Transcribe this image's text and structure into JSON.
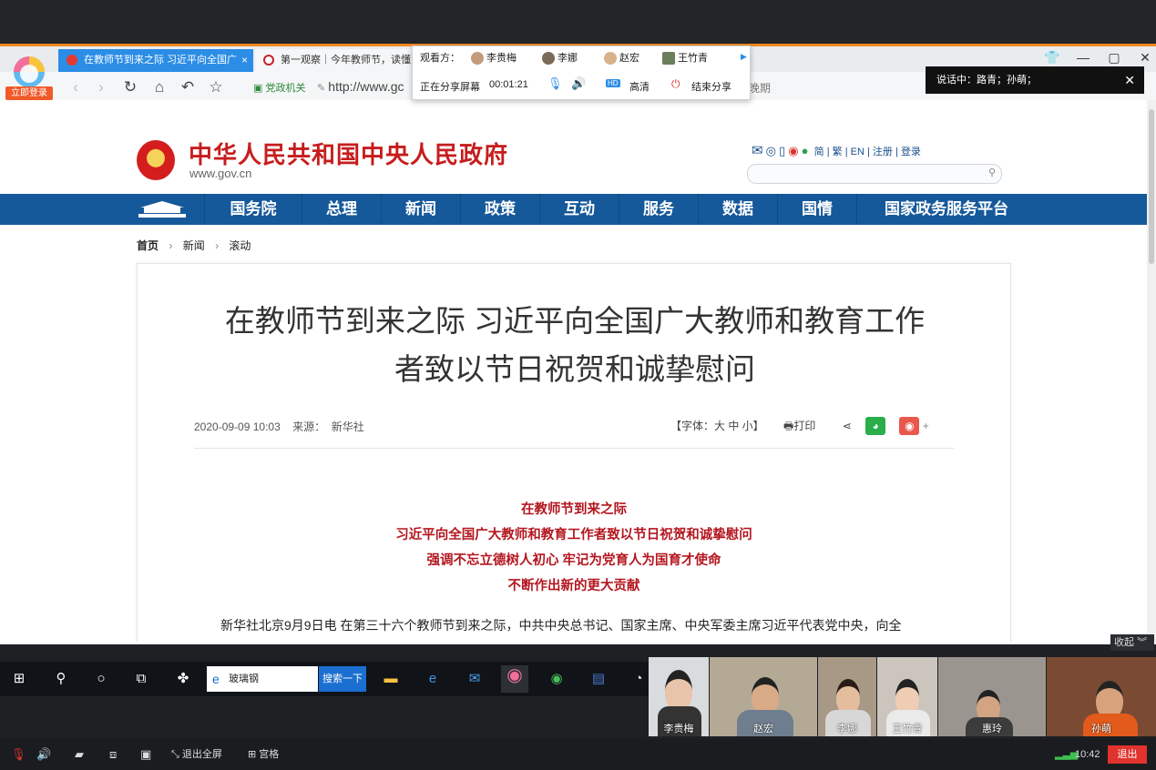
{
  "browser": {
    "tabs": [
      {
        "label": "在教师节到来之际 习近平向全国广",
        "close": "×"
      },
      {
        "label": "第一观察｜今年教师节，读懂"
      }
    ],
    "login_label": "立即登录",
    "bookmark1": "党政机关",
    "address": "http://www.gc",
    "address_tail": "晚期",
    "window_buttons": {
      "min": "—",
      "max": "▢",
      "close": "✕"
    }
  },
  "share": {
    "viewers_label": "观看方：",
    "viewers": [
      "李贵梅",
      "李娜",
      "赵宏",
      "王竹青"
    ],
    "sharing_label": "正在分享屏幕",
    "timer": "00:01:21",
    "hd_badge": "HD",
    "hd_label": "高清",
    "end_label": "结束分享"
  },
  "speaking": {
    "text": "说话中：路青；孙萌；",
    "close": "✕"
  },
  "site": {
    "name": "中华人民共和国中央人民政府",
    "url": "www.gov.cn",
    "top_links": [
      "简",
      "繁",
      "EN",
      "注册",
      "登录"
    ],
    "nav": [
      "国务院",
      "总理",
      "新闻",
      "政策",
      "互动",
      "服务",
      "数据",
      "国情",
      "国家政务服务平台"
    ],
    "breadcrumb": [
      "首页",
      "新闻",
      "滚动"
    ]
  },
  "article": {
    "title_line1": "在教师节到来之际 习近平向全国广大教师和教育工作",
    "title_line2": "者致以节日祝贺和诚挚慰问",
    "date": "2020-09-09 10:03",
    "source_label": "来源：",
    "source": "新华社",
    "font_size_label": "【字体：大 中 小】",
    "print_label": "打印",
    "lead": [
      "在教师节到来之际",
      "习近平向全国广大教师和教育工作者致以节日祝贺和诚挚慰问",
      "强调不忘立德树人初心 牢记为党育人为国育才使命",
      "不断作出新的更大贡献"
    ],
    "paragraph": "新华社北京9月9日电  在第三十六个教师节到来之际，中共中央总书记、国家主席、中央军委主席习近平代表党中央，向全"
  },
  "taskbar": {
    "search_value": "玻璃钢",
    "search_button": "搜索一下"
  },
  "participants": [
    "李贵梅",
    "赵宏",
    "李娜",
    "王竹青",
    "惠玲",
    "孙萌"
  ],
  "meeting": {
    "collapse_label": "收起",
    "exit_fullscreen": "退出全屏",
    "grid_label": "宫格",
    "time": "10:42",
    "exit_label": "退出"
  },
  "colors": {
    "accent_orange": "#f08a24",
    "tab_blue": "#2b8de6",
    "gov_red": "#c61d1d",
    "nav_blue": "#16599b",
    "lead_red": "#b4161f",
    "exit_red": "#e0332e"
  }
}
